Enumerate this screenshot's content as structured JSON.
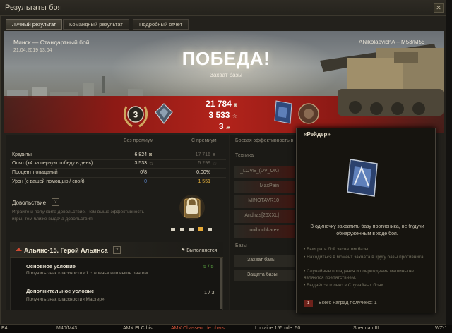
{
  "window": {
    "title": "Результаты боя",
    "close_glyph": "✕"
  },
  "tabs": [
    {
      "label": "Личный результат",
      "active": true
    },
    {
      "label": "Командный результат",
      "active": false
    },
    {
      "label": "Подробный отчёт",
      "active": false
    }
  ],
  "battle": {
    "map_mode": "Минск — Стандартный бой",
    "date": "21.04.2019 13:04",
    "player_vehicle": "ANikolaevichA – M53/M55",
    "result": "ПОБЕДА!",
    "result_reason": "Захват базы"
  },
  "badges": {
    "rank_number": "3"
  },
  "earnings": {
    "credits": "21 784",
    "xp": "3 533",
    "free_xp": "3"
  },
  "stats": {
    "col_no_premium": "Без премиум",
    "col_premium": "С премиум",
    "rows": [
      {
        "label": "Кредиты",
        "base": "6 824",
        "premium": "17 716"
      },
      {
        "label": "Опыт  (x4 за первую победу в день)",
        "base": "3 533",
        "premium": "5 299"
      },
      {
        "label": "Процент попаданий",
        "base": "0/8",
        "premium": "0,00%"
      },
      {
        "label": "Урон (с вашей помощью / свой)",
        "base": "0",
        "premium": "1 551"
      }
    ]
  },
  "satisfaction": {
    "title": "Довольствие",
    "help_glyph": "?",
    "desc": "Играйте и получайте довольствие. Чем выше эффективность игры, тем ближе выдача довольствия."
  },
  "mission": {
    "title": "Альянс-15. Герой Альянса",
    "info_glyph": "?",
    "status": "Выполняется",
    "main_title": "Основное условие",
    "main_desc": "Получить знак классности «1 степень» или выше рангом.",
    "main_progress": "5 / 5",
    "add_title": "Дополнительное условие",
    "add_desc": "Получить знак классности «Мастер».",
    "add_progress": "1 / 3"
  },
  "efficiency": {
    "title": "Боевая эффективность в",
    "tech_label": "Техника",
    "players": [
      "_LOVE_(DV_OK)",
      "MaxPain",
      "MINOTAVR10",
      "Andiras[26XXL]",
      "unibochkarev"
    ],
    "bases_label": "Базы",
    "base_rows": [
      "Захват базы",
      "Защита базы"
    ]
  },
  "tooltip": {
    "title": "«Рейдер»",
    "desc": "В одиночку захватить базу противника, не будучи обнаруженным в ходе боя.",
    "bullets": [
      "• Выиграть бой захватом базы.",
      "• Находиться в момент захвата в кругу базы противника.",
      "• Случайные попадания и повреждения машины не являются препятствием.",
      "• Выдаётся только в Случайных боях."
    ],
    "count_badge": "1",
    "count_text": "Всего наград получено: 1"
  },
  "carousel": [
    "E4",
    "M40/M43",
    "AMX ELC bis",
    "AMX Chasseur de chars",
    "Lorraine 155 mle. 50",
    "Sherman III",
    "WZ-1"
  ],
  "colors": {
    "victory_red": "#b2231b",
    "gold": "#e6b13a",
    "blue": "#5b84c8",
    "green": "#58a040"
  }
}
